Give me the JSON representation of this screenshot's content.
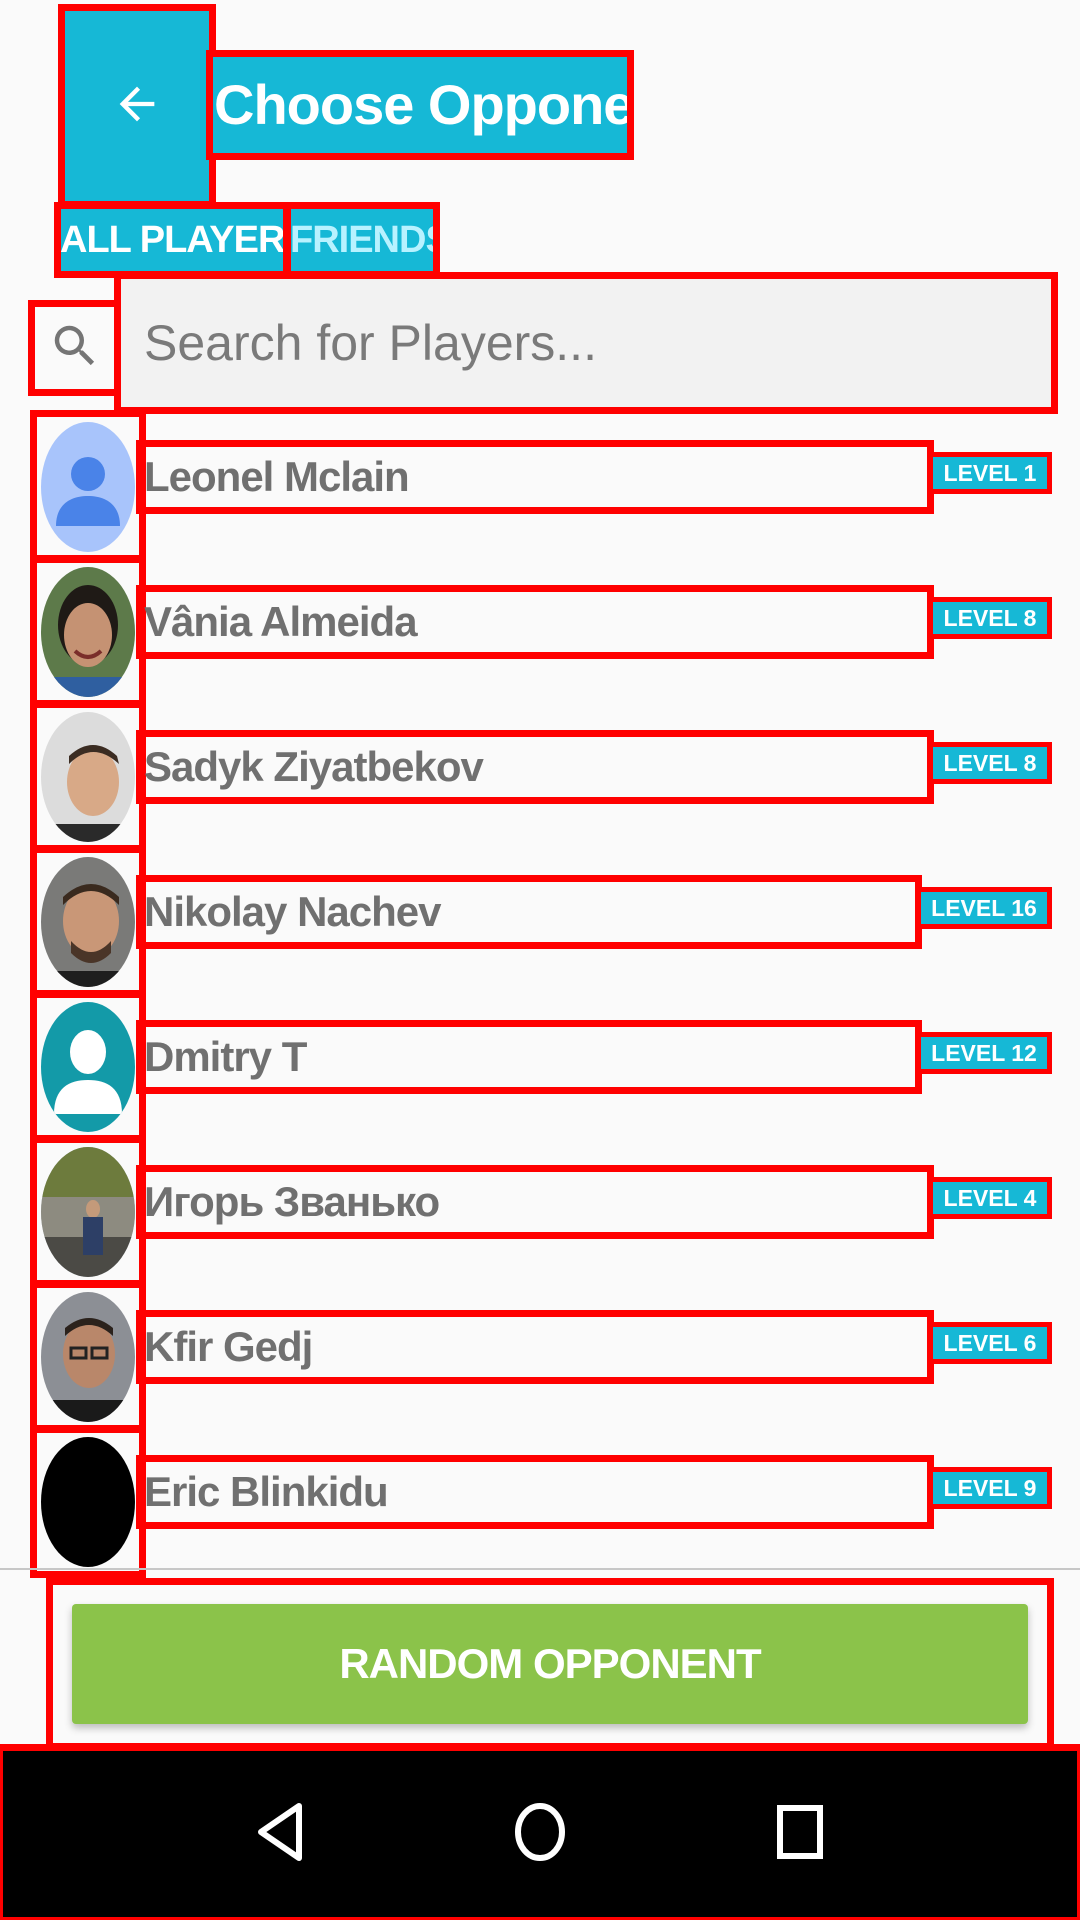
{
  "header": {
    "title": "Choose Opponent",
    "back_icon": "arrow-left-icon"
  },
  "tabs": [
    {
      "label": "ALL PLAYERS",
      "selected": true
    },
    {
      "label": "FRIENDS",
      "selected": false
    }
  ],
  "search": {
    "placeholder": "Search for Players...",
    "icon": "search-icon"
  },
  "players": [
    {
      "name": "Leonel Mclain",
      "level": "LEVEL 1",
      "avatar": "default-avatar-icon"
    },
    {
      "name": "Vânia Almeida",
      "level": "LEVEL 8",
      "avatar": "profile-photo"
    },
    {
      "name": "Sadyk Ziyatbekov",
      "level": "LEVEL 8",
      "avatar": "profile-photo"
    },
    {
      "name": "Nikolay Nachev",
      "level": "LEVEL 16",
      "avatar": "profile-photo"
    },
    {
      "name": "Dmitry T",
      "level": "LEVEL 12",
      "avatar": "default-avatar-icon"
    },
    {
      "name": "Игорь Званько",
      "level": "LEVEL 4",
      "avatar": "profile-photo"
    },
    {
      "name": "Kfir Gedj",
      "level": "LEVEL 6",
      "avatar": "profile-photo"
    },
    {
      "name": "Eric Blinkidu",
      "level": "LEVEL 9",
      "avatar": "profile-photo"
    }
  ],
  "random_button": {
    "label": "RANDOM OPPONENT"
  },
  "navbar": {
    "back_icon": "nav-back-icon",
    "home_icon": "nav-home-icon",
    "recents_icon": "nav-recents-icon"
  },
  "colors": {
    "accent": "#16b8d6",
    "random_button": "#8bc34a",
    "annotation": "#ff0000",
    "navbar": "#000000"
  }
}
